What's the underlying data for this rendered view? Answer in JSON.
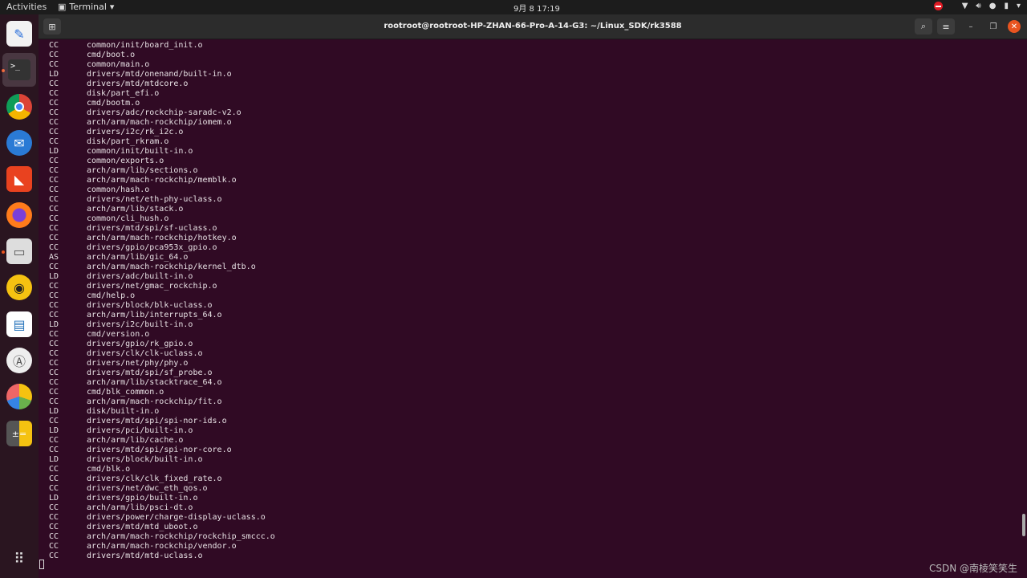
{
  "topbar": {
    "activities": "Activities",
    "app_name": "Terminal",
    "clock": "9月 8  17:19"
  },
  "window": {
    "title": "rootroot@rootroot-HP-ZHAN-66-Pro-A-14-G3: ~/Linux_SDK/rk3588"
  },
  "dock": [
    "text-editor",
    "terminal",
    "chrome",
    "thunderbird",
    "software-app",
    "firefox",
    "files",
    "rhythmbox",
    "libreoffice-writer",
    "software-center",
    "pie-app",
    "calculator"
  ],
  "colors": {
    "terminal_bg": "#300a24",
    "close": "#e95420"
  },
  "lines": [
    [
      "CC",
      "common/init/board_init.o"
    ],
    [
      "CC",
      "cmd/boot.o"
    ],
    [
      "CC",
      "common/main.o"
    ],
    [
      "LD",
      "drivers/mtd/onenand/built-in.o"
    ],
    [
      "CC",
      "drivers/mtd/mtdcore.o"
    ],
    [
      "CC",
      "disk/part_efi.o"
    ],
    [
      "CC",
      "cmd/bootm.o"
    ],
    [
      "CC",
      "drivers/adc/rockchip-saradc-v2.o"
    ],
    [
      "CC",
      "arch/arm/mach-rockchip/iomem.o"
    ],
    [
      "CC",
      "drivers/i2c/rk_i2c.o"
    ],
    [
      "CC",
      "disk/part_rkram.o"
    ],
    [
      "LD",
      "common/init/built-in.o"
    ],
    [
      "CC",
      "common/exports.o"
    ],
    [
      "CC",
      "arch/arm/lib/sections.o"
    ],
    [
      "CC",
      "arch/arm/mach-rockchip/memblk.o"
    ],
    [
      "CC",
      "common/hash.o"
    ],
    [
      "CC",
      "drivers/net/eth-phy-uclass.o"
    ],
    [
      "CC",
      "arch/arm/lib/stack.o"
    ],
    [
      "CC",
      "common/cli_hush.o"
    ],
    [
      "CC",
      "drivers/mtd/spi/sf-uclass.o"
    ],
    [
      "CC",
      "arch/arm/mach-rockchip/hotkey.o"
    ],
    [
      "CC",
      "drivers/gpio/pca953x_gpio.o"
    ],
    [
      "AS",
      "arch/arm/lib/gic_64.o"
    ],
    [
      "CC",
      "arch/arm/mach-rockchip/kernel_dtb.o"
    ],
    [
      "LD",
      "drivers/adc/built-in.o"
    ],
    [
      "CC",
      "drivers/net/gmac_rockchip.o"
    ],
    [
      "CC",
      "cmd/help.o"
    ],
    [
      "CC",
      "drivers/block/blk-uclass.o"
    ],
    [
      "CC",
      "arch/arm/lib/interrupts_64.o"
    ],
    [
      "LD",
      "drivers/i2c/built-in.o"
    ],
    [
      "CC",
      "cmd/version.o"
    ],
    [
      "CC",
      "drivers/gpio/rk_gpio.o"
    ],
    [
      "CC",
      "drivers/clk/clk-uclass.o"
    ],
    [
      "CC",
      "drivers/net/phy/phy.o"
    ],
    [
      "CC",
      "drivers/mtd/spi/sf_probe.o"
    ],
    [
      "CC",
      "arch/arm/lib/stacktrace_64.o"
    ],
    [
      "CC",
      "cmd/blk_common.o"
    ],
    [
      "CC",
      "arch/arm/mach-rockchip/fit.o"
    ],
    [
      "LD",
      "disk/built-in.o"
    ],
    [
      "CC",
      "drivers/mtd/spi/spi-nor-ids.o"
    ],
    [
      "LD",
      "drivers/pci/built-in.o"
    ],
    [
      "CC",
      "arch/arm/lib/cache.o"
    ],
    [
      "CC",
      "drivers/mtd/spi/spi-nor-core.o"
    ],
    [
      "LD",
      "drivers/block/built-in.o"
    ],
    [
      "CC",
      "cmd/blk.o"
    ],
    [
      "CC",
      "drivers/clk/clk_fixed_rate.o"
    ],
    [
      "CC",
      "drivers/net/dwc_eth_qos.o"
    ],
    [
      "LD",
      "drivers/gpio/built-in.o"
    ],
    [
      "CC",
      "arch/arm/lib/psci-dt.o"
    ],
    [
      "CC",
      "drivers/power/charge-display-uclass.o"
    ],
    [
      "CC",
      "drivers/mtd/mtd_uboot.o"
    ],
    [
      "CC",
      "arch/arm/mach-rockchip/rockchip_smccc.o"
    ],
    [
      "CC",
      "arch/arm/mach-rockchip/vendor.o"
    ],
    [
      "CC",
      "drivers/mtd/mtd-uclass.o"
    ]
  ],
  "watermark": "CSDN @南棱笑笑生"
}
